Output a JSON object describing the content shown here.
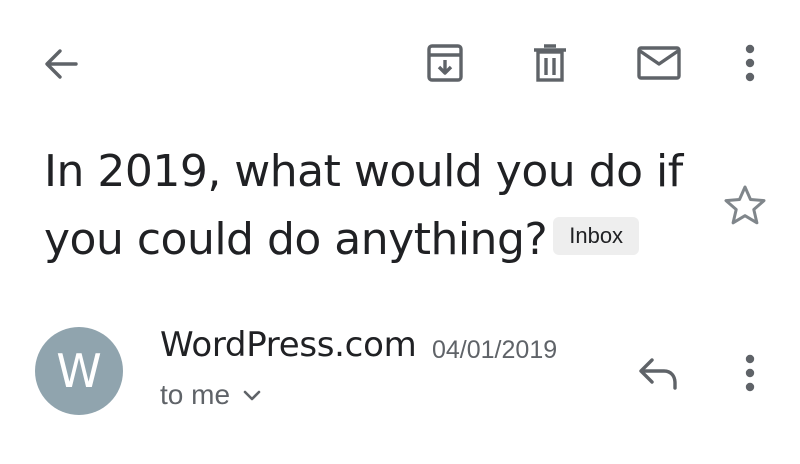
{
  "toolbar": {
    "back_icon": "arrow-left-icon",
    "archive_icon": "archive-icon",
    "delete_icon": "trash-icon",
    "mark_unread_icon": "envelope-icon",
    "more_icon": "more-vert-icon"
  },
  "email": {
    "subject": "In 2019, what would you do if you could do anything?",
    "label": "Inbox",
    "starred": false,
    "sender": {
      "avatar_letter": "W",
      "avatar_color": "#90a4ae",
      "name": "WordPress.com",
      "date": "04/01/2019",
      "recipient": "to me"
    }
  },
  "colors": {
    "icon": "#5f6368",
    "text": "#202124",
    "badge_bg": "#eeeeee"
  }
}
